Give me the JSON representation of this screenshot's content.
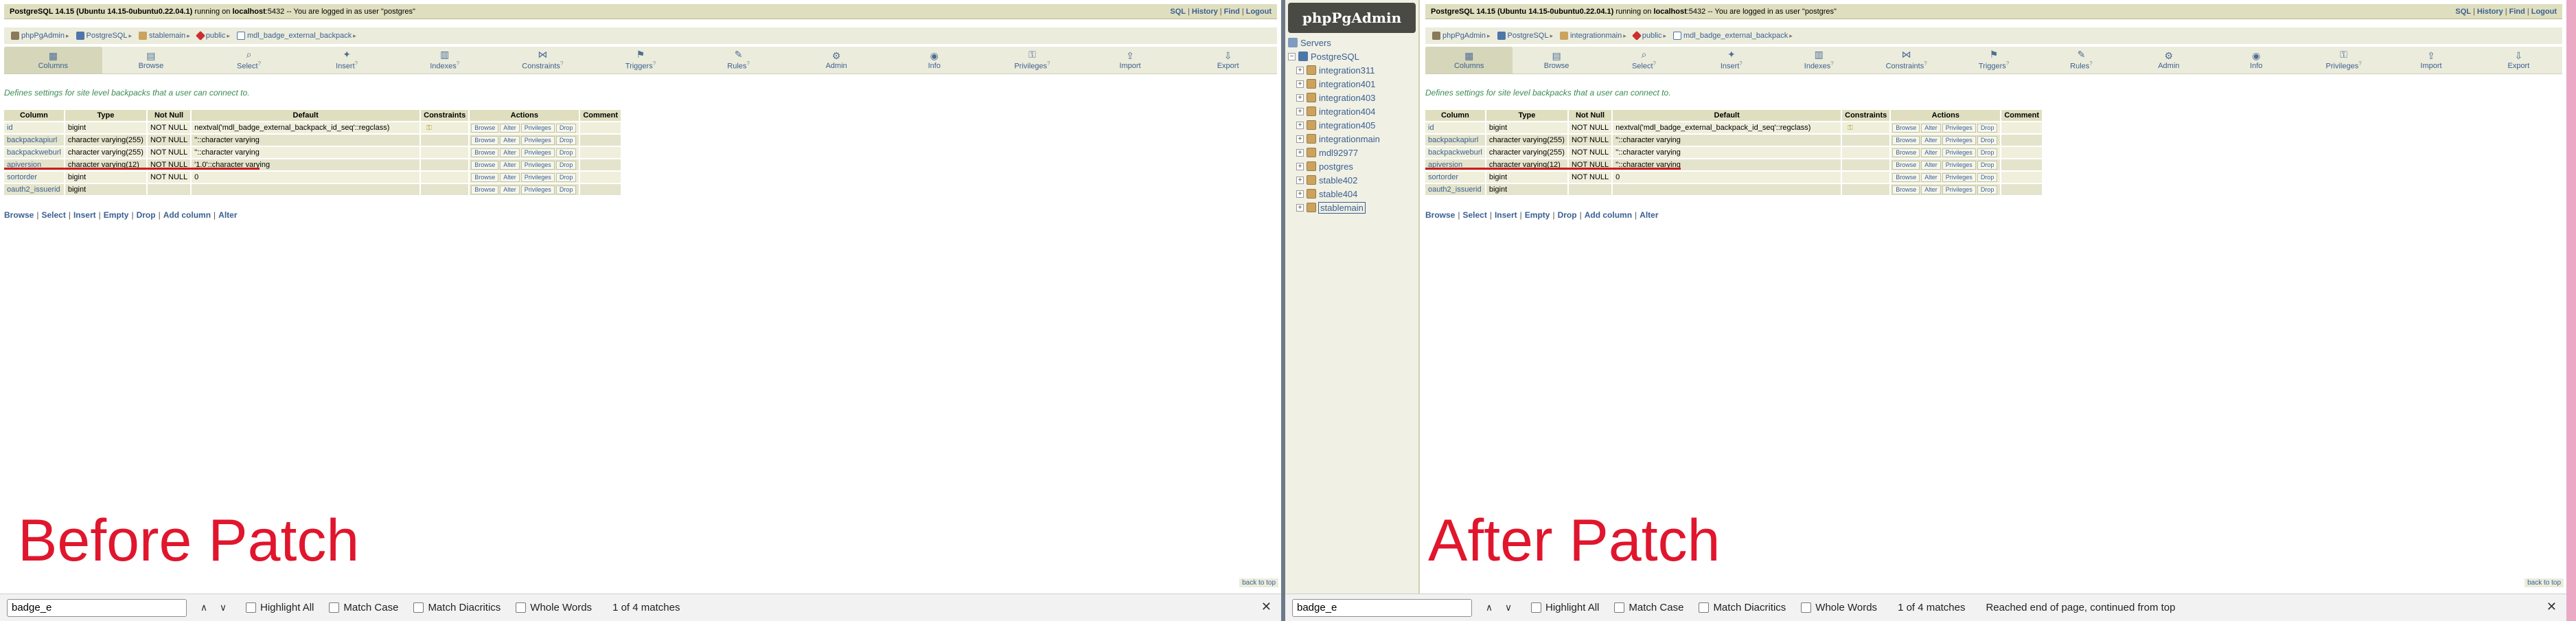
{
  "topbar": {
    "server_name": "PostgreSQL 14.15 (Ubuntu 14.15-0ubuntu0.22.04.1)",
    "running_on": "running on",
    "host": "localhost",
    "port_user": ":5432 -- You are logged in as user \"postgres\"",
    "links": [
      "SQL",
      "History",
      "Find",
      "Logout"
    ]
  },
  "left_trail": [
    "phpPgAdmin",
    "PostgreSQL",
    "stablemain",
    "public",
    "mdl_badge_external_backpack"
  ],
  "right_trail": [
    "phpPgAdmin",
    "PostgreSQL",
    "integrationmain",
    "public",
    "mdl_badge_external_backpack"
  ],
  "tabs": [
    {
      "label": "Columns",
      "glyph": "▦",
      "hint": ""
    },
    {
      "label": "Browse",
      "glyph": "▤",
      "hint": ""
    },
    {
      "label": "Select",
      "glyph": "⌕",
      "hint": "?"
    },
    {
      "label": "Insert",
      "glyph": "✦",
      "hint": "?"
    },
    {
      "label": "Indexes",
      "glyph": "▥",
      "hint": "?"
    },
    {
      "label": "Constraints",
      "glyph": "⋈",
      "hint": "?"
    },
    {
      "label": "Triggers",
      "glyph": "⚑",
      "hint": "?"
    },
    {
      "label": "Rules",
      "glyph": "✎",
      "hint": "?"
    },
    {
      "label": "Admin",
      "glyph": "⚙",
      "hint": ""
    },
    {
      "label": "Info",
      "glyph": "◉",
      "hint": ""
    },
    {
      "label": "Privileges",
      "glyph": "⚿",
      "hint": "?"
    },
    {
      "label": "Import",
      "glyph": "⇪",
      "hint": ""
    },
    {
      "label": "Export",
      "glyph": "⇩",
      "hint": ""
    }
  ],
  "intro_text": "Defines settings for site level backpacks that a user can connect to.",
  "table_headers": [
    "Column",
    "Type",
    "Not Null",
    "Default",
    "Constraints",
    "Actions",
    "Comment"
  ],
  "action_labels": [
    "Browse",
    "Alter",
    "Privileges",
    "Drop"
  ],
  "left_rows": [
    {
      "column": "id",
      "type": "bigint",
      "notnull": "NOT NULL",
      "default": "nextval('mdl_badge_external_backpack_id_seq'::regclass)"
    },
    {
      "column": "backpackapiurl",
      "type": "character varying(255)",
      "notnull": "NOT NULL",
      "default": "''::character varying"
    },
    {
      "column": "backpackweburl",
      "type": "character varying(255)",
      "notnull": "NOT NULL",
      "default": "''::character varying"
    },
    {
      "column": "apiversion",
      "type": "character varying(12)",
      "notnull": "NOT NULL",
      "default": "'1.0'::character varying"
    },
    {
      "column": "sortorder",
      "type": "bigint",
      "notnull": "NOT NULL",
      "default": "0"
    },
    {
      "column": "oauth2_issuerid",
      "type": "bigint",
      "notnull": "",
      "default": ""
    }
  ],
  "right_rows": [
    {
      "column": "id",
      "type": "bigint",
      "notnull": "NOT NULL",
      "default": "nextval('mdl_badge_external_backpack_id_seq'::regclass)"
    },
    {
      "column": "backpackapiurl",
      "type": "character varying(255)",
      "notnull": "NOT NULL",
      "default": "''::character varying"
    },
    {
      "column": "backpackweburl",
      "type": "character varying(255)",
      "notnull": "NOT NULL",
      "default": "''::character varying"
    },
    {
      "column": "apiversion",
      "type": "character varying(12)",
      "notnull": "NOT NULL",
      "default": "''::character varying"
    },
    {
      "column": "sortorder",
      "type": "bigint",
      "notnull": "NOT NULL",
      "default": "0"
    },
    {
      "column": "oauth2_issuerid",
      "type": "bigint",
      "notnull": "",
      "default": ""
    }
  ],
  "bottom_links": [
    "Browse",
    "Select",
    "Insert",
    "Empty",
    "Drop",
    "Add column",
    "Alter"
  ],
  "back_to_top": "back to top",
  "captions": {
    "left": "Before Patch",
    "right": "After Patch"
  },
  "tree": {
    "logo": "phpPgAdmin",
    "servers": "Servers",
    "server": "PostgreSQL",
    "databases": [
      "integration311",
      "integration401",
      "integration403",
      "integration404",
      "integration405",
      "integrationmain",
      "mdl92977",
      "postgres",
      "stable402",
      "stable404",
      "stablemain"
    ]
  },
  "findbar": {
    "query": "badge_e",
    "options": [
      "Highlight All",
      "Match Case",
      "Match Diacritics",
      "Whole Words"
    ],
    "status": "1 of 4 matches",
    "right_message": "Reached end of page, continued from top"
  },
  "colors": {
    "accent": "#3a5f91",
    "caption": "#e0162d",
    "highlight_line": "#cc1d1d"
  }
}
